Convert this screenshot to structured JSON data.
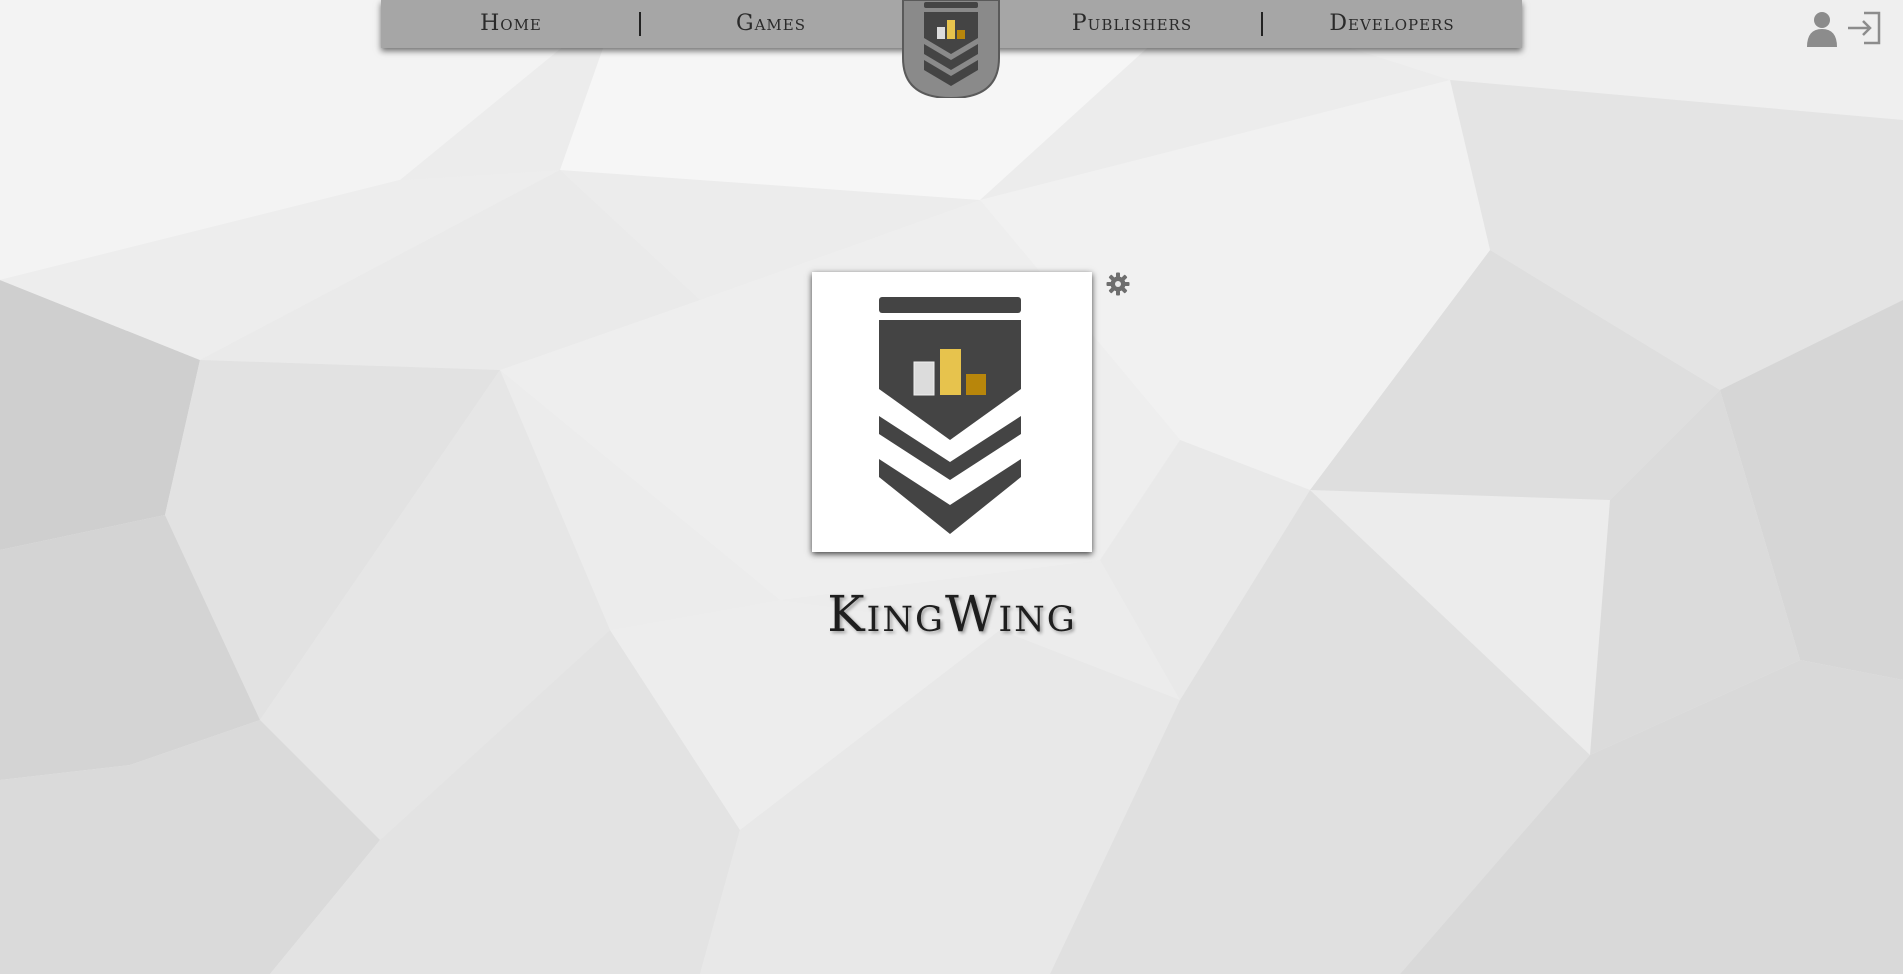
{
  "nav": {
    "items": [
      {
        "label": "Home"
      },
      {
        "label": "Games"
      },
      {
        "label": "Publishers"
      },
      {
        "label": "Developers"
      }
    ]
  },
  "header_right": {
    "icons": [
      "user-icon",
      "login-icon"
    ]
  },
  "main": {
    "title": "KingWing",
    "settings_icon": "gear-icon"
  },
  "colors": {
    "nav_background": "#a6a6a6",
    "emblem_dark": "#444444",
    "bar_light": "#dcdcdc",
    "bar_yellow": "#e7c34d",
    "bar_gold": "#b8860b",
    "page_background": "#ebebeb"
  }
}
